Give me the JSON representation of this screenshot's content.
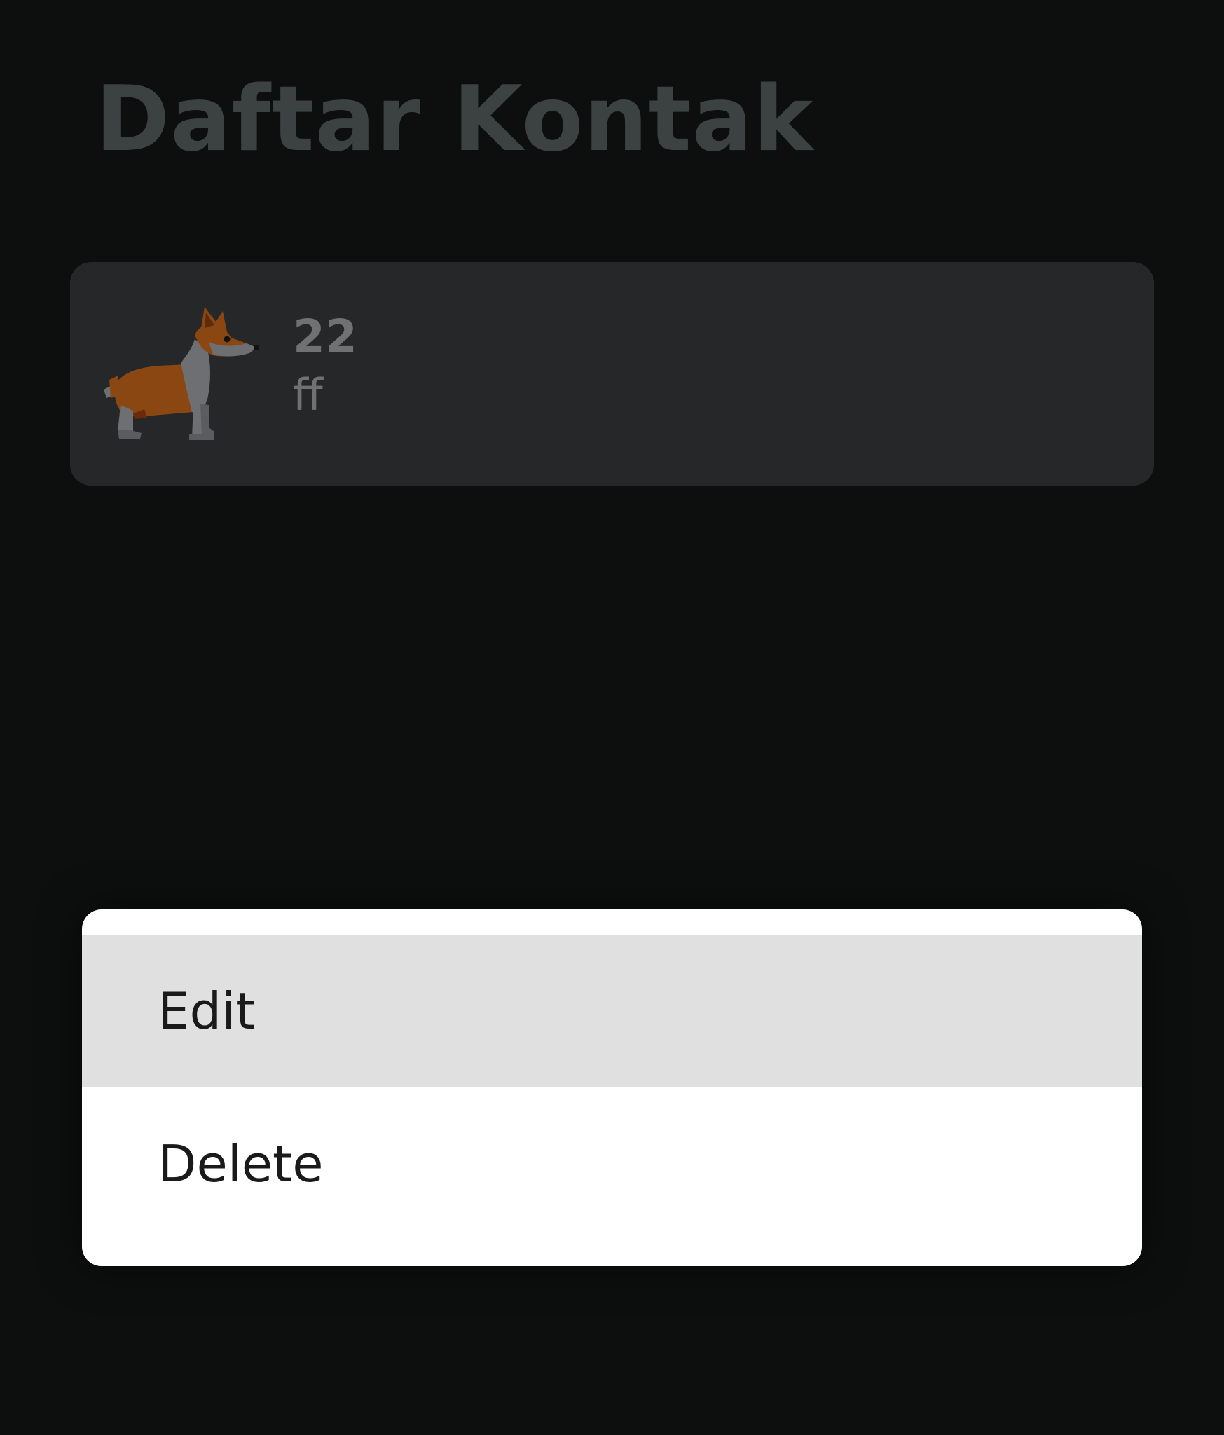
{
  "header": {
    "title": "Daftar Kontak"
  },
  "contacts": [
    {
      "name": "22",
      "detail": "ff",
      "avatar_icon": "corgi-dog-icon"
    }
  ],
  "context_menu": {
    "items": [
      {
        "label": "Edit",
        "highlighted": true
      },
      {
        "label": "Delete",
        "highlighted": false
      }
    ]
  },
  "colors": {
    "background": "#0d0e0e",
    "card": "#262729",
    "title": "#3c4242",
    "contact_text": "#6f7273",
    "menu_background": "#ffffff",
    "menu_highlight": "#e0e0e0",
    "menu_text": "#1a1a1a"
  }
}
